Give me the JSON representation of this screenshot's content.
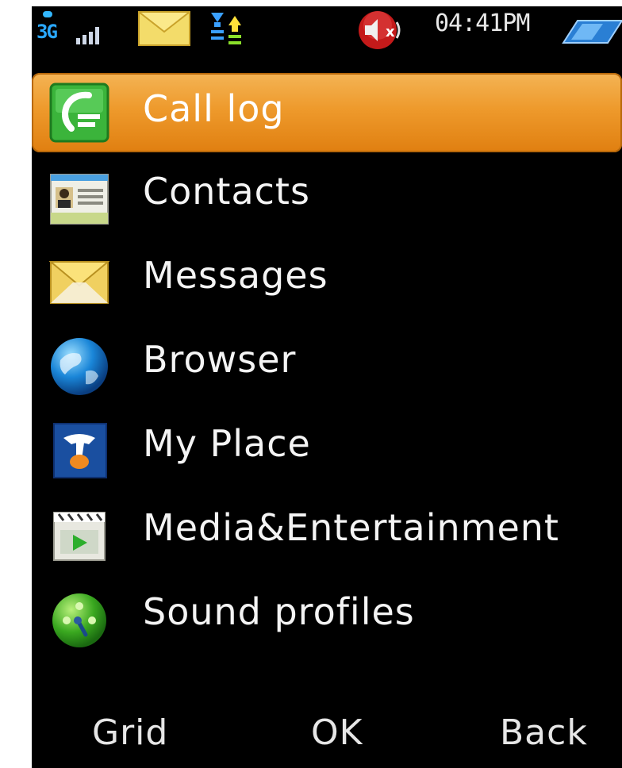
{
  "status_bar": {
    "network": "3G",
    "time": "04:41PM",
    "icons": [
      "signal-3g-icon",
      "new-message-icon",
      "data-transfer-icon",
      "muted-speaker-icon",
      "battery-icon"
    ]
  },
  "menu": {
    "items": [
      {
        "label": "Call log",
        "icon": "call-log-icon",
        "selected": true
      },
      {
        "label": "Contacts",
        "icon": "contacts-card-icon",
        "selected": false
      },
      {
        "label": "Messages",
        "icon": "envelope-icon",
        "selected": false
      },
      {
        "label": "Browser",
        "icon": "globe-icon",
        "selected": false
      },
      {
        "label": "My Place",
        "icon": "telstra-t-icon",
        "selected": false
      },
      {
        "label": "Media&Entertainment",
        "icon": "media-player-icon",
        "selected": false
      },
      {
        "label": "Sound profiles",
        "icon": "sound-profile-icon",
        "selected": false
      }
    ]
  },
  "softkeys": {
    "left": "Grid",
    "center": "OK",
    "right": "Back"
  },
  "colors": {
    "background": "#000000",
    "selection": "#ee9a2c",
    "text": "#f4f4f4",
    "network_blue": "#2aa8ff"
  }
}
